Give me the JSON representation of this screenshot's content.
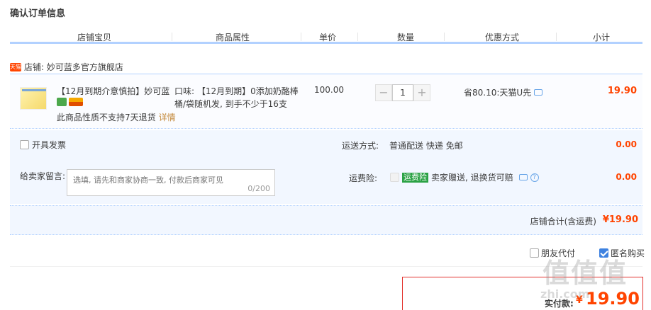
{
  "page_title": "确认订单信息",
  "columns": [
    "店铺宝贝",
    "商品属性",
    "单价",
    "数量",
    "优惠方式",
    "小计"
  ],
  "shop": {
    "tag": "天猫",
    "label": "店铺: 妙可蓝多官方旗舰店"
  },
  "item": {
    "name": "【12月到期介意慎拍】妙可蓝...",
    "no_refund": "此商品性质不支持7天退货",
    "details_link": "详情",
    "attr_line1": "口味: 【12月到期】0添加奶酪棒",
    "attr_line2": "桶/袋随机发, 到手不少于16支",
    "price": "100.00",
    "quantity": "1",
    "qty_minus": "−",
    "qty_plus": "+",
    "promo": "省80.10:天猫U先",
    "subtotal": "19.90"
  },
  "invoice_label": "开具发票",
  "message": {
    "label": "给卖家留言:",
    "placeholder": "选填, 请先和商家协商一致, 付款后商家可见",
    "count": "0/200"
  },
  "shipping": {
    "label": "运送方式:",
    "value": "普通配送 快递 免邮",
    "fee": "0.00"
  },
  "insurance": {
    "label": "运费险:",
    "tag": "运费险",
    "value": "卖家赠送, 退换货可赔",
    "fee": "0.00"
  },
  "shop_total": {
    "label": "店铺合计(含运费)",
    "value": "¥19.90"
  },
  "friend_pay": {
    "label": "朋友代付",
    "checked": false
  },
  "anon_buy": {
    "label": "匿名购买",
    "checked": true
  },
  "payable": {
    "label": "实付款:",
    "symbol": "¥",
    "value": "19.90"
  },
  "watermark": {
    "main": "值值值",
    "sub": "zhi.com"
  },
  "colors": {
    "accent": "#ff4400",
    "border_blue": "#b2d1ff",
    "panel": "#f2f7ff"
  }
}
